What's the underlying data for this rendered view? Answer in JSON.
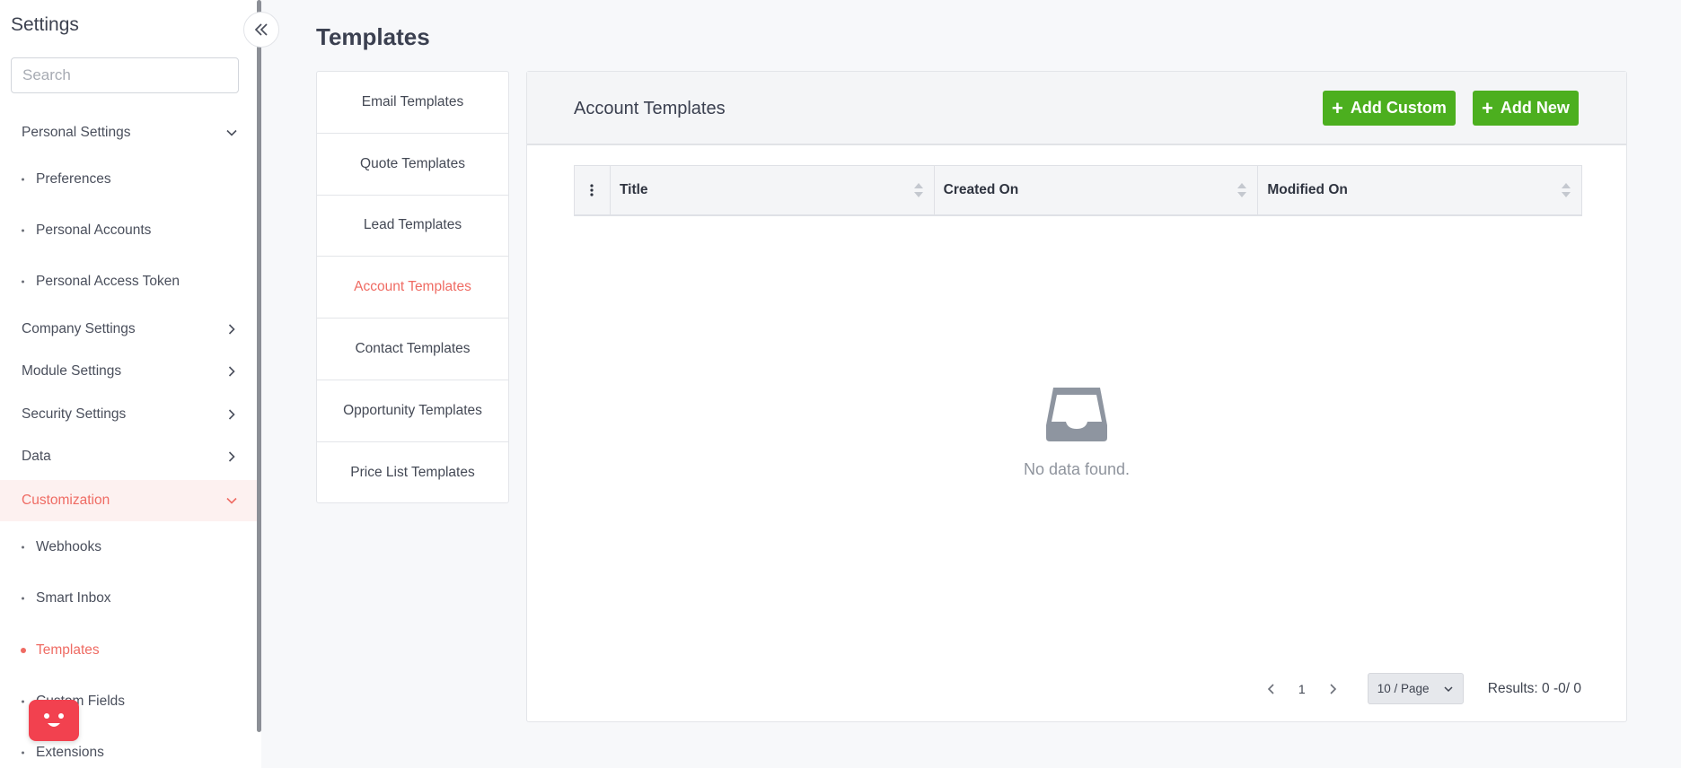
{
  "sidebar": {
    "title": "Settings",
    "search_placeholder": "Search",
    "groups": [
      {
        "label": "Personal Settings",
        "expanded": true
      },
      {
        "label": "Company Settings",
        "expanded": false
      },
      {
        "label": "Module Settings",
        "expanded": false
      },
      {
        "label": "Security Settings",
        "expanded": false
      },
      {
        "label": "Data",
        "expanded": false
      },
      {
        "label": "Customization",
        "expanded": true,
        "active": true
      }
    ],
    "personal_items": [
      "Preferences",
      "Personal Accounts",
      "Personal Access Token"
    ],
    "customization_items": [
      "Webhooks",
      "Smart Inbox",
      "Templates",
      "Custom Fields",
      "Extensions"
    ],
    "active_item": "Templates"
  },
  "page": {
    "title": "Templates"
  },
  "template_types": [
    "Email Templates",
    "Quote Templates",
    "Lead Templates",
    "Account Templates",
    "Contact Templates",
    "Opportunity Templates",
    "Price List Templates"
  ],
  "active_template_type": "Account Templates",
  "panel": {
    "title": "Account Templates",
    "add_custom_label": "Add Custom",
    "add_new_label": "Add New"
  },
  "table": {
    "columns": [
      "Title",
      "Created On",
      "Modified On"
    ],
    "rows": [],
    "empty_text": "No data found."
  },
  "pagination": {
    "current_page": "1",
    "page_size": "10 / Page",
    "results": "Results: 0 -0/ 0"
  },
  "colors": {
    "accent": "#ef6b63",
    "primary_button": "#4caf1f",
    "bot_button": "#f2414f"
  }
}
